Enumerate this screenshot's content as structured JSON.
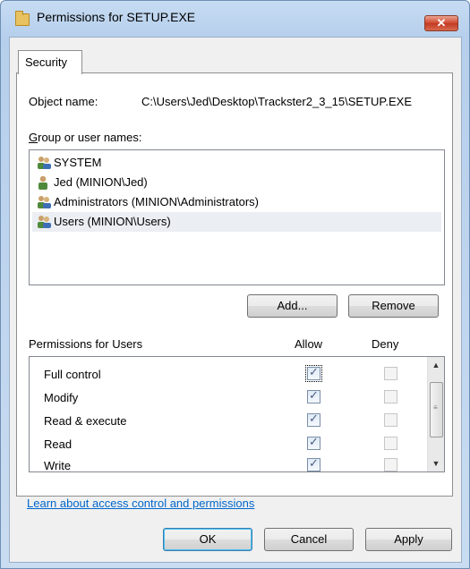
{
  "window": {
    "title": "Permissions for SETUP.EXE",
    "close_label": "✕"
  },
  "tabs": [
    {
      "label": "Security"
    }
  ],
  "object": {
    "label": "Object name:",
    "value": "C:\\Users\\Jed\\Desktop\\Trackster2_3_15\\SETUP.EXE"
  },
  "groups": {
    "label": "Group or user names:",
    "items": [
      {
        "label": "SYSTEM",
        "icon": "user-group-icon"
      },
      {
        "label": "Jed (MINION\\Jed)",
        "icon": "user-icon"
      },
      {
        "label": "Administrators (MINION\\Administrators)",
        "icon": "user-group-icon"
      },
      {
        "label": "Users (MINION\\Users)",
        "icon": "user-group-icon"
      }
    ],
    "selected": "Users (MINION\\Users)"
  },
  "buttons": {
    "add": "Add...",
    "remove": "Remove",
    "ok": "OK",
    "cancel": "Cancel",
    "apply": "Apply"
  },
  "permissions": {
    "label": "Permissions for Users",
    "allow_header": "Allow",
    "deny_header": "Deny",
    "rows": [
      {
        "label": "Full control",
        "allow": true,
        "deny": false
      },
      {
        "label": "Modify",
        "allow": true,
        "deny": false
      },
      {
        "label": "Read & execute",
        "allow": true,
        "deny": false
      },
      {
        "label": "Read",
        "allow": true,
        "deny": false
      },
      {
        "label": "Write",
        "allow": true,
        "deny": false
      }
    ]
  },
  "link": {
    "text": "Learn about access control and permissions"
  },
  "colors": {
    "title_bar": "#b6cfec",
    "close_button": "#c23a22",
    "link": "#0066cc"
  }
}
